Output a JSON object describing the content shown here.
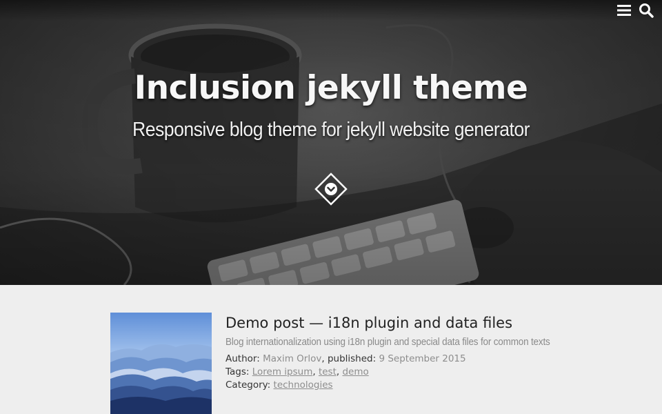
{
  "hero": {
    "title": "Inclusion jekyll theme",
    "subtitle": "Responsive blog theme for jekyll website generator"
  },
  "topbar": {
    "icons": [
      "menu-icon",
      "search-icon"
    ]
  },
  "post": {
    "title": "Demo post — i18n plugin and data files",
    "description": "Blog internationalization using i18n plugin and special data files for common texts",
    "author_label": "Author:",
    "author": "Maxim Orlov",
    "published_label": "published:",
    "date": "9 September 2015",
    "tags_label": "Tags:",
    "tags": [
      "Lorem ipsum",
      "test",
      "demo"
    ],
    "category_label": "Category:",
    "category": "technologies"
  },
  "colors": {
    "page_background": "#eeeeee",
    "title_text": "#222222",
    "muted_text": "#8d8d8d",
    "hero_text": "#f7f7f7"
  }
}
